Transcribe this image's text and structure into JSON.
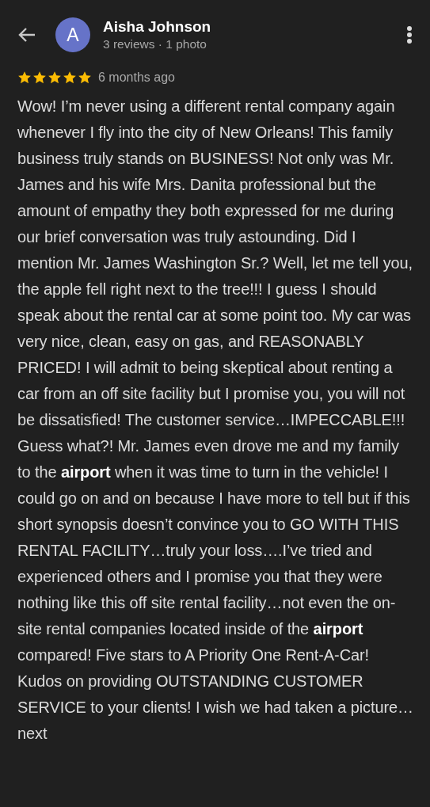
{
  "reviewer": {
    "initial": "A",
    "name": "Aisha Johnson",
    "meta": "3 reviews · 1 photo"
  },
  "review": {
    "stars": 5,
    "time": "6 months ago",
    "text": "Wow! I’m never using a different rental company again whenever I fly into the city of New Orleans! This family business truly stands on BUSINESS! Not only was Mr. James and his wife Mrs. Danita professional but the amount of empathy they both expressed for me during our brief conversation was truly astounding. Did I mention Mr. James Washington Sr.? Well, let me tell you, the apple fell right next to the tree!!! I guess I should speak about the rental car at some point too. My car was very nice, clean, easy on gas, and REASONABLY PRICED! I will admit to being skeptical about renting a car from an off site facility but I promise you, you will not be dissatisfied! The customer service…IMPECCABLE!!! Guess what?! Mr. James even drove me and my family to the **airport** when it was time to turn in the vehicle! I could go on and on because I have more to tell but if this short synopsis doesn’t convince you to GO WITH THIS RENTAL FACILITY…truly your loss….I’ve tried and experienced others and I promise you that they were nothing like this off site rental facility…not even the on-site rental companies located inside of the **airport** compared! Five stars to A Priority One Rent-A-Car! Kudos on providing OUTSTANDING CUSTOMER SERVICE to your clients! I wish we had taken a picture…next"
  }
}
